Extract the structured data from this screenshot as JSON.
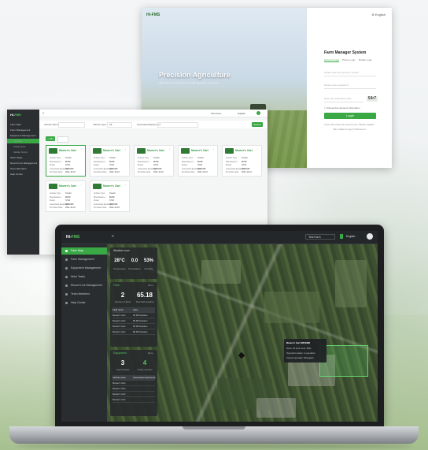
{
  "login": {
    "logo": "Hi-FMS",
    "language": "English",
    "hero_title": "Precision Agriculture",
    "hero_subtitle": "Make the farm the backbone, make agriculture the future",
    "panel_title": "Farm Manager System",
    "tabs": [
      "Account Login",
      "Phone Login",
      "Mobile Login"
    ],
    "username_placeholder": "Please enter the account number",
    "password_placeholder": "Please enter password",
    "captcha_placeholder": "Enter the verification code",
    "captcha_text": "54r7",
    "remember_label": "Remember account information",
    "login_button": "Login",
    "register_link": "If you don't have an account yet, Please register",
    "forgot_link": "Be unable to log in? Retrieve it"
  },
  "equipment": {
    "logo_prefix": "Hi-",
    "logo_suffix": "FMS",
    "menu": [
      {
        "label": "Farm Map",
        "active": false,
        "sub": false
      },
      {
        "label": "Farm Management",
        "active": false,
        "sub": false
      },
      {
        "label": "Equipment Management",
        "active": false,
        "sub": false
      },
      {
        "label": "Vehicles",
        "active": true,
        "sub": true
      },
      {
        "label": "Implements",
        "active": false,
        "sub": true
      },
      {
        "label": "Mobile Terms",
        "active": false,
        "sub": true
      },
      {
        "label": "Work Tasks",
        "active": false,
        "sub": false
      },
      {
        "label": "Record Live Management",
        "active": false,
        "sub": false
      },
      {
        "label": "Team Members",
        "active": false,
        "sub": false
      },
      {
        "label": "Help Center",
        "active": false,
        "sub": false
      }
    ],
    "farm_name": "Test Farm",
    "language": "English",
    "filter_name_label": "Vehicle Name:",
    "filter_type_label": "Vehicle Type:",
    "filter_type_value": "All",
    "filter_assoc_label": "Associated Equipment:",
    "search_button": "Search",
    "add_button": "+ Add",
    "cards": [
      {
        "name": "Mower's Cart",
        "rows": [
          [
            "Vehicle Type",
            "Tractor"
          ],
          [
            "Manufacturer",
            "BMSF"
          ],
          [
            "Model",
            "ST40"
          ],
          [
            "Associated Equipment",
            "SRF9486"
          ],
          [
            "Purchase Date",
            "2021-10-16"
          ]
        ]
      },
      {
        "name": "Mower's Cart",
        "rows": [
          [
            "Vehicle Type",
            "Tractor"
          ],
          [
            "Manufacturer",
            "BMSF"
          ],
          [
            "Model",
            "ST40"
          ],
          [
            "Associated Equipment",
            "SRF9486"
          ],
          [
            "Purchase Date",
            "2021-10-16"
          ]
        ]
      },
      {
        "name": "Mower's Cart",
        "rows": [
          [
            "Vehicle Type",
            "Tractor"
          ],
          [
            "Manufacturer",
            "BMSF"
          ],
          [
            "Model",
            "ST40"
          ],
          [
            "Associated Equipment",
            "SRF9486"
          ],
          [
            "Purchase Date",
            "2021-10-16"
          ]
        ]
      },
      {
        "name": "Mower's Cart",
        "rows": [
          [
            "Vehicle Type",
            "Tractor"
          ],
          [
            "Manufacturer",
            "BMSF"
          ],
          [
            "Model",
            "ST40"
          ],
          [
            "Associated Equipment",
            "SRF9486"
          ],
          [
            "Purchase Date",
            "2021-10-16"
          ]
        ]
      },
      {
        "name": "Mower's Cart",
        "rows": [
          [
            "Vehicle Type",
            "Tractor"
          ],
          [
            "Manufacturer",
            "BMSF"
          ],
          [
            "Model",
            "ST40"
          ],
          [
            "Associated Equipment",
            "SRF9486"
          ],
          [
            "Purchase Date",
            "2021-10-16"
          ]
        ]
      },
      {
        "name": "Mower's Cart",
        "rows": [
          [
            "Vehicle Type",
            "Tractor"
          ],
          [
            "Manufacturer",
            "BMSF"
          ],
          [
            "Model",
            "ST40"
          ],
          [
            "Associated Equipment",
            "SRF9486"
          ],
          [
            "Purchase Date",
            "2021-10-16"
          ]
        ]
      },
      {
        "name": "Mower's Cart",
        "rows": [
          [
            "Vehicle Type",
            "Tractor"
          ],
          [
            "Manufacturer",
            "BMSF"
          ],
          [
            "Model",
            "ST40"
          ],
          [
            "Associated Equipment",
            "SRF9486"
          ],
          [
            "Purchase Date",
            "2021-10-16"
          ]
        ]
      }
    ]
  },
  "dashboard": {
    "logo_prefix": "Hi-",
    "logo_suffix": "FMS",
    "farm_name": "Test Farm",
    "language": "English",
    "menu": [
      {
        "label": "Farm Map",
        "active": true
      },
      {
        "label": "Farm Management",
        "active": false
      },
      {
        "label": "Equipment Management",
        "active": false
      },
      {
        "label": "Work Tasks",
        "active": false
      },
      {
        "label": "Record Live Management",
        "active": false
      },
      {
        "label": "Team Members",
        "active": false
      },
      {
        "label": "Help Center",
        "active": false
      }
    ],
    "weather": {
      "title": "Weather now",
      "temp": "28°C",
      "temp_label": "Temperature",
      "rain": "0.0",
      "rain_label": "Precipitation",
      "humidity": "53%",
      "humidity_label": "Humidity"
    },
    "farm": {
      "title": "Farm",
      "more": "More",
      "count": "2",
      "count_label": "Number of fields",
      "area": "65.18",
      "area_label": "Total field area(ha)",
      "table_header": [
        "Field name",
        "Area"
      ],
      "rows": [
        [
          "Mower's Cart",
          "65.98 hectares"
        ],
        [
          "Mower's Cart",
          "65.98 hectares"
        ],
        [
          "Mower's Cart",
          "65.98 hectares"
        ],
        [
          "Mower's Cart",
          "65.98 hectares"
        ]
      ]
    },
    "equipment": {
      "title": "Equipment",
      "more": "More",
      "vehicles": "3",
      "vehicles_label": "Total vehicles",
      "implements": "4",
      "implements_label": "Online vehicles",
      "table_header": [
        "Vehicle name",
        "Associated implements"
      ],
      "rows": [
        [
          "Mower's Cart",
          ""
        ],
        [
          "Mower's Cart",
          ""
        ],
        [
          "Mower's Cart",
          ""
        ],
        [
          "Mower's Cart",
          ""
        ]
      ]
    },
    "popup": {
      "title": "Mower's Cart  SRF9486",
      "line1": "Work: 20 km/h  Fuel: 68%",
      "line2": "Operation status: In operation",
      "line3": "Current operator: Zhangsan"
    }
  }
}
